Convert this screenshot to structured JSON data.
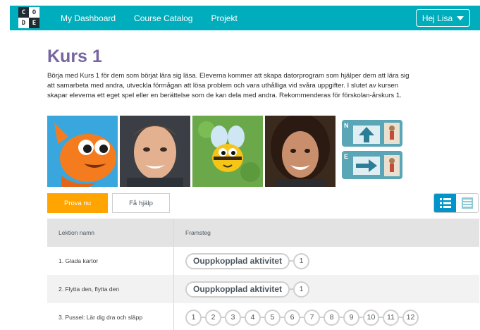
{
  "header": {
    "logo_letters": [
      "C",
      "O",
      "D",
      "E"
    ],
    "nav": [
      "My Dashboard",
      "Course Catalog",
      "Projekt"
    ],
    "user_label": "Hej Lisa",
    "bar_color": "#00adbc"
  },
  "course": {
    "title": "Kurs 1",
    "description": "Börja med Kurs 1 för dem som börjat lära sig läsa. Eleverna kommer att skapa datorprogram som hjälper dem att lära sig att samarbeta med andra, utveckla förmågan att lösa problem och vara uthålliga vid svåra uppgifter. I slutet av kursen skapar eleverna ett eget spel eller en berättelse som de kan dela med andra. Rekommenderas för förskolan-årskurs 1.",
    "title_color": "#7665a0"
  },
  "thumbnails": {
    "t5_labels": [
      "N",
      "E"
    ]
  },
  "buttons": {
    "try": "Prova nu",
    "help": "Få hjälp",
    "try_color": "#ffa400"
  },
  "table": {
    "headers": {
      "name": "Lektion namn",
      "progress": "Framsteg"
    },
    "rows": [
      {
        "name": "1. Glada kartor",
        "pill": "Ouppkopplad aktivitet",
        "bubbles": [
          "1"
        ]
      },
      {
        "name": "2. Flytta den, flytta den",
        "pill": "Ouppkopplad aktivitet",
        "bubbles": [
          "1"
        ]
      },
      {
        "name": "3. Pussel: Lär dig dra och släpp",
        "pill": "",
        "bubbles": [
          "1",
          "2",
          "3",
          "4",
          "5",
          "6",
          "7",
          "8",
          "9",
          "10",
          "11",
          "12"
        ]
      }
    ]
  },
  "icons": {
    "view_detail": "list-detail-icon",
    "view_summary": "list-summary-icon",
    "caret": "caret-down-icon"
  }
}
